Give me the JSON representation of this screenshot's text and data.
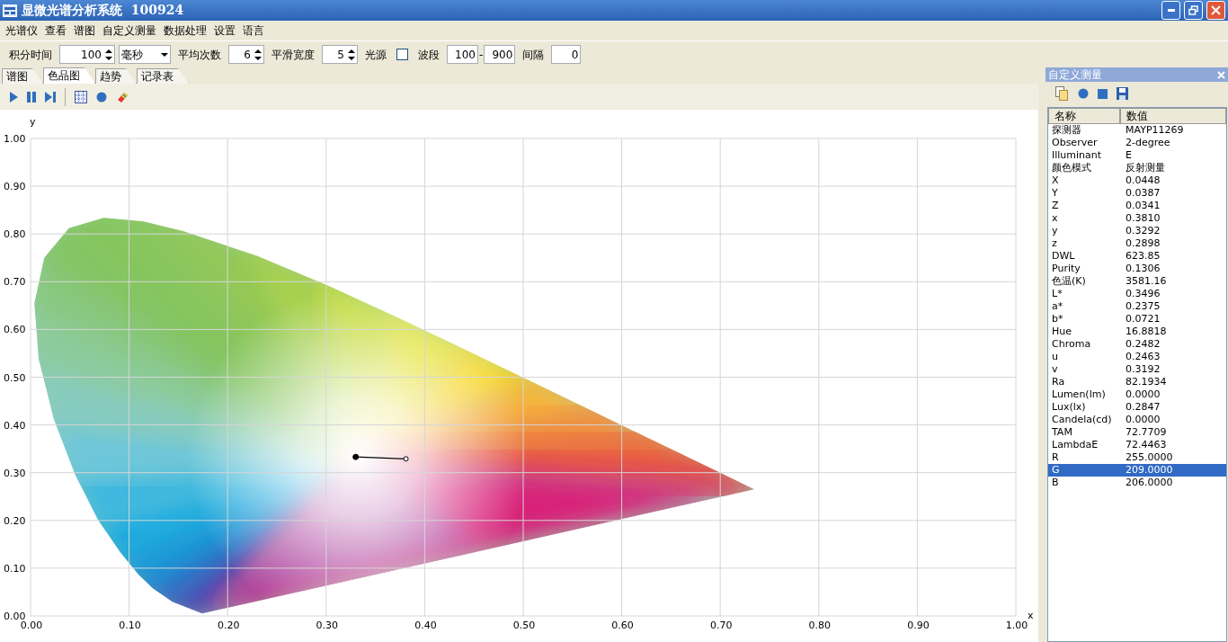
{
  "window": {
    "title": "显微光谱分析系统  100924"
  },
  "menu": [
    "光谱仪",
    "查看",
    "谱图",
    "自定义测量",
    "数据处理",
    "设置",
    "语言"
  ],
  "toolbar": [
    {
      "kind": "label",
      "text": "积分时间"
    },
    {
      "kind": "spinner",
      "value": "100"
    },
    {
      "kind": "dropdown",
      "value": "毫秒"
    },
    {
      "kind": "label",
      "text": "平均次数"
    },
    {
      "kind": "spinner",
      "value": "6"
    },
    {
      "kind": "label",
      "text": "平滑宽度"
    },
    {
      "kind": "spinner",
      "value": "5"
    },
    {
      "kind": "label",
      "text": "光源"
    },
    {
      "kind": "checkbox",
      "checked": false
    },
    {
      "kind": "label",
      "text": "波段"
    },
    {
      "kind": "textbox",
      "value": "100"
    },
    {
      "kind": "dash",
      "text": "-"
    },
    {
      "kind": "textbox",
      "value": "900"
    },
    {
      "kind": "label",
      "text": "间隔"
    },
    {
      "kind": "textbox",
      "value": "0"
    }
  ],
  "tabs": [
    {
      "label": "谱图",
      "selected": false
    },
    {
      "label": "色品图",
      "selected": true
    },
    {
      "label": "趋势",
      "selected": false
    },
    {
      "label": "记录表",
      "selected": false
    }
  ],
  "chart": {
    "chart_data": {
      "type": "line",
      "xlabel": "x",
      "ylabel": "y",
      "x": [
        0.33,
        0.381
      ],
      "series": [
        {
          "color": "#000000",
          "marker": "circle",
          "values": [
            0.333,
            0.329
          ]
        }
      ],
      "grid": true,
      "xlim": [
        0,
        1
      ],
      "ylim": [
        0,
        1
      ],
      "xticks": [
        {
          "value": 0,
          "label": "0.00"
        },
        {
          "value": 0.1,
          "label": "0.10"
        },
        {
          "value": 0.2,
          "label": "0.20"
        },
        {
          "value": 0.3,
          "label": "0.30"
        },
        {
          "value": 0.4,
          "label": "0.40"
        },
        {
          "value": 0.5,
          "label": "0.50"
        },
        {
          "value": 0.6,
          "label": "0.60"
        },
        {
          "value": 0.7,
          "label": "0.70"
        },
        {
          "value": 0.8,
          "label": "0.80"
        },
        {
          "value": 0.9,
          "label": "0.90"
        },
        {
          "value": 1,
          "label": "1.00"
        }
      ],
      "yticks": [
        {
          "value": 0,
          "label": "0.00"
        },
        {
          "value": 0.1,
          "label": "0.10"
        },
        {
          "value": 0.2,
          "label": "0.20"
        },
        {
          "value": 0.3,
          "label": "0.30"
        },
        {
          "value": 0.4,
          "label": "0.40"
        },
        {
          "value": 0.5,
          "label": "0.50"
        },
        {
          "value": 0.6,
          "label": "0.60"
        },
        {
          "value": 0.7,
          "label": "0.70"
        },
        {
          "value": 0.8,
          "label": "0.80"
        },
        {
          "value": 0.9,
          "label": "0.90"
        },
        {
          "value": 1,
          "label": "1.00"
        }
      ]
    }
  },
  "panel": {
    "title": "自定义测量",
    "table": {
      "columns": [
        "名称",
        "数值"
      ],
      "rows": [
        {
          "name": "探测器",
          "value": "MAYP11269",
          "selected": false
        },
        {
          "name": "Observer",
          "value": "2-degree",
          "selected": false
        },
        {
          "name": "Illuminant",
          "value": "E",
          "selected": false
        },
        {
          "name": "颜色模式",
          "value": "反射测量",
          "selected": false
        },
        {
          "name": "X",
          "value": "0.0448",
          "selected": false
        },
        {
          "name": "Y",
          "value": "0.0387",
          "selected": false
        },
        {
          "name": "Z",
          "value": "0.0341",
          "selected": false
        },
        {
          "name": "x",
          "value": "0.3810",
          "selected": false
        },
        {
          "name": "y",
          "value": "0.3292",
          "selected": false
        },
        {
          "name": "z",
          "value": "0.2898",
          "selected": false
        },
        {
          "name": "DWL",
          "value": "623.85",
          "selected": false
        },
        {
          "name": "Purity",
          "value": "0.1306",
          "selected": false
        },
        {
          "name": "色温(K)",
          "value": "3581.16",
          "selected": false
        },
        {
          "name": "L*",
          "value": "0.3496",
          "selected": false
        },
        {
          "name": "a*",
          "value": "0.2375",
          "selected": false
        },
        {
          "name": "b*",
          "value": "0.0721",
          "selected": false
        },
        {
          "name": "Hue",
          "value": "16.8818",
          "selected": false
        },
        {
          "name": "Chroma",
          "value": "0.2482",
          "selected": false
        },
        {
          "name": "u",
          "value": "0.2463",
          "selected": false
        },
        {
          "name": "v",
          "value": "0.3192",
          "selected": false
        },
        {
          "name": "Ra",
          "value": "82.1934",
          "selected": false
        },
        {
          "name": "Lumen(lm)",
          "value": "0.0000",
          "selected": false
        },
        {
          "name": "Lux(lx)",
          "value": "0.2847",
          "selected": false
        },
        {
          "name": "Candela(cd)",
          "value": "0.0000",
          "selected": false
        },
        {
          "name": "TAM",
          "value": "72.7709",
          "selected": false
        },
        {
          "name": "LambdaE",
          "value": "72.4463",
          "selected": false
        },
        {
          "name": "R",
          "value": "255.0000",
          "selected": false
        },
        {
          "name": "G",
          "value": "209.0000",
          "selected": true
        },
        {
          "name": "B",
          "value": "206.0000",
          "selected": false
        }
      ]
    }
  }
}
